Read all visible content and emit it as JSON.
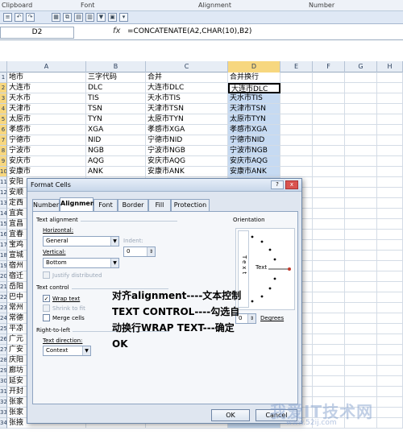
{
  "ribbon": {
    "groups": [
      "Clipboard",
      "Font",
      "Alignment",
      "Number"
    ]
  },
  "formula_bar": {
    "name_box": "D2",
    "fx": "fx",
    "formula": "=CONCATENATE(A2,CHAR(10),B2)"
  },
  "columns": [
    "A",
    "B",
    "C",
    "D",
    "E",
    "F",
    "G",
    "H"
  ],
  "rows": [
    {
      "n": "1",
      "a": "地市",
      "b": "三字代码",
      "c": "合并",
      "d": "合并换行"
    },
    {
      "n": "2",
      "a": "大连市",
      "b": "DLC",
      "c": "大连市DLC",
      "d": "大连市DLC"
    },
    {
      "n": "3",
      "a": "天水市",
      "b": "TIS",
      "c": "天水市TIS",
      "d": "天水市TIS"
    },
    {
      "n": "4",
      "a": "天津市",
      "b": "TSN",
      "c": "天津市TSN",
      "d": "天津市TSN"
    },
    {
      "n": "5",
      "a": "太原市",
      "b": "TYN",
      "c": "太原市TYN",
      "d": "太原市TYN"
    },
    {
      "n": "6",
      "a": "孝感市",
      "b": "XGA",
      "c": "孝感市XGA",
      "d": "孝感市XGA"
    },
    {
      "n": "7",
      "a": "宁德市",
      "b": "NID",
      "c": "宁德市NID",
      "d": "宁德市NID"
    },
    {
      "n": "8",
      "a": "宁波市",
      "b": "NGB",
      "c": "宁波市NGB",
      "d": "宁波市NGB"
    },
    {
      "n": "9",
      "a": "安庆市",
      "b": "AQG",
      "c": "安庆市AQG",
      "d": "安庆市AQG"
    },
    {
      "n": "10",
      "a": "安康市",
      "b": "ANK",
      "c": "安康市ANK",
      "d": "安康市ANK"
    },
    {
      "n": "11",
      "a": "安阳",
      "b": "",
      "c": "",
      "d": ""
    },
    {
      "n": "12",
      "a": "安顺",
      "b": "",
      "c": "",
      "d": ""
    },
    {
      "n": "13",
      "a": "定西",
      "b": "",
      "c": "",
      "d": ""
    },
    {
      "n": "14",
      "a": "宜宾",
      "b": "",
      "c": "",
      "d": ""
    },
    {
      "n": "15",
      "a": "宜昌",
      "b": "",
      "c": "",
      "d": ""
    },
    {
      "n": "16",
      "a": "宜春",
      "b": "",
      "c": "",
      "d": ""
    },
    {
      "n": "17",
      "a": "宝鸡",
      "b": "",
      "c": "",
      "d": ""
    },
    {
      "n": "18",
      "a": "宣城",
      "b": "",
      "c": "",
      "d": ""
    },
    {
      "n": "19",
      "a": "宿州",
      "b": "",
      "c": "",
      "d": ""
    },
    {
      "n": "20",
      "a": "宿迁",
      "b": "",
      "c": "",
      "d": ""
    },
    {
      "n": "21",
      "a": "岳阳",
      "b": "",
      "c": "",
      "d": ""
    },
    {
      "n": "22",
      "a": "巴中",
      "b": "",
      "c": "",
      "d": ""
    },
    {
      "n": "23",
      "a": "常州",
      "b": "",
      "c": "",
      "d": ""
    },
    {
      "n": "24",
      "a": "常德",
      "b": "",
      "c": "",
      "d": ""
    },
    {
      "n": "25",
      "a": "平凉",
      "b": "",
      "c": "",
      "d": ""
    },
    {
      "n": "26",
      "a": "广元",
      "b": "",
      "c": "",
      "d": ""
    },
    {
      "n": "27",
      "a": "广安",
      "b": "",
      "c": "",
      "d": ""
    },
    {
      "n": "28",
      "a": "庆阳",
      "b": "",
      "c": "",
      "d": ""
    },
    {
      "n": "29",
      "a": "廊坊",
      "b": "",
      "c": "",
      "d": ""
    },
    {
      "n": "30",
      "a": "延安",
      "b": "",
      "c": "",
      "d": ""
    },
    {
      "n": "31",
      "a": "开封",
      "b": "",
      "c": "",
      "d": ""
    },
    {
      "n": "32",
      "a": "张家",
      "b": "",
      "c": "",
      "d": ""
    },
    {
      "n": "33",
      "a": "张家",
      "b": "",
      "c": "",
      "d": ""
    },
    {
      "n": "34",
      "a": "张掖",
      "b": "",
      "c": "",
      "d": ""
    }
  ],
  "dialog": {
    "title": "Format Cells",
    "help": "?",
    "close": "x",
    "tabs": [
      "Number",
      "Alignment",
      "Font",
      "Border",
      "Fill",
      "Protection"
    ],
    "text_alignment": "Text alignment",
    "horizontal_label": "Horizontal:",
    "horizontal_value": "General",
    "vertical_label": "Vertical:",
    "vertical_value": "Bottom",
    "indent_label": "Indent:",
    "indent_value": "0",
    "justify_distributed": "Justify distributed",
    "text_control": "Text control",
    "wrap_text": "Wrap text",
    "shrink_to_fit": "Shrink to fit",
    "merge_cells": "Merge cells",
    "right_to_left": "Right-to-left",
    "text_direction_label": "Text direction:",
    "text_direction_value": "Context",
    "orientation": "Orientation",
    "vertical_text": "Text",
    "text_word": "Text",
    "degrees_value": "0",
    "degrees_label": "Degrees",
    "ok": "OK",
    "cancel": "Cancel"
  },
  "annotation": [
    "对齐alignment----文本控制",
    "TEXT CONTROL----勾选自",
    "动换行WRAP TEXT---确定",
    "OK"
  ],
  "watermark": {
    "main": "我爱IT技术网",
    "url": "www.52ij.com"
  }
}
